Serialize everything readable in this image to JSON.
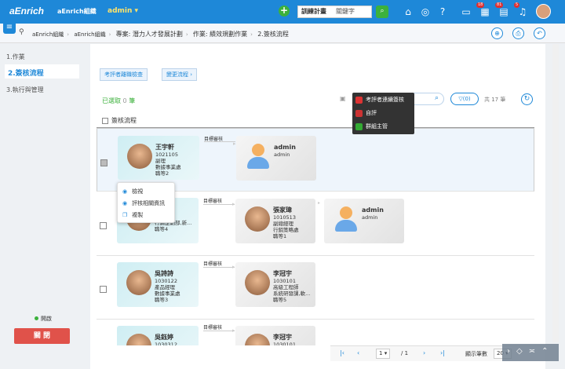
{
  "topbar": {
    "logo": "aEnrich",
    "org": "aEnrich組織",
    "user": "admin",
    "plus": "+",
    "select": {
      "value": "訓練計畫",
      "placeholder": "關鍵字"
    },
    "search": "⌕",
    "icons": [
      "home-icon",
      "compass-icon",
      "help-icon",
      "message-icon",
      "calendar-icon",
      "task-icon",
      "bell-icon"
    ],
    "badges": [
      "18",
      "81",
      "5"
    ],
    "colors": {
      "bar": "#1e88d8",
      "green": "#3cb13c"
    }
  },
  "breadcrumb": {
    "items": [
      "aEnrich組織",
      "aEnrich組織",
      "專案: 潛力人才發展計劃",
      "作業: 績效規劃作業",
      "2.簽核流程"
    ]
  },
  "sidebar": {
    "items": [
      {
        "label": "1.作業"
      },
      {
        "label": "2.簽核流程"
      },
      {
        "label": "3.執行與管理"
      }
    ],
    "status": "開啟",
    "close": "關 閉"
  },
  "toolbar": {
    "check_btn": "考評者離職檢查",
    "change_btn": "變更流程 ›",
    "selected_label": "已選取",
    "selected_count": "0",
    "selected_unit": "筆",
    "filter": "(0)",
    "total": "共 17 筆"
  },
  "legend": {
    "items": [
      {
        "label": "考評者連續簽核",
        "color": "#d33"
      },
      {
        "label": "自評",
        "color": "#c33"
      },
      {
        "label": "群組主管",
        "color": "#3a3"
      }
    ]
  },
  "table": {
    "header": "簽核流程",
    "step_label": "目標審核",
    "rows": [
      {
        "cards": [
          {
            "name": "王宇軒",
            "id": "1021105",
            "title": "副理",
            "dept": "數據事業處",
            "level": "職等2"
          },
          {
            "name": "admin",
            "id": "admin"
          }
        ]
      },
      {
        "cards": [
          {
            "name": "",
            "id": "",
            "title": "行銷經理",
            "dept": "行銷企劃部,新...",
            "level": "職等4"
          },
          {
            "name": "張家瑋",
            "id": "1010513",
            "title": "副總經理",
            "dept": "行銷策略處",
            "level": "職等1"
          },
          {
            "name": "admin",
            "id": "admin"
          }
        ]
      },
      {
        "cards": [
          {
            "name": "吳詩詩",
            "id": "1030122",
            "title": "產品經理",
            "dept": "數據事業處",
            "level": "職等3"
          },
          {
            "name": "李冠宇",
            "id": "1030101",
            "title": "高級工程師",
            "dept": "系統研發課,軟...",
            "level": "職等5"
          }
        ]
      },
      {
        "cards": [
          {
            "name": "吳鈺婷",
            "id": "1030312"
          },
          {
            "name": "李冠宇",
            "id": "1030101"
          }
        ]
      }
    ]
  },
  "popup": {
    "items": [
      "檢視",
      "評核相關資訊",
      "複製"
    ]
  },
  "pager": {
    "page": "1",
    "of": "/ 1",
    "per_label": "顯示筆數",
    "per": "20"
  }
}
